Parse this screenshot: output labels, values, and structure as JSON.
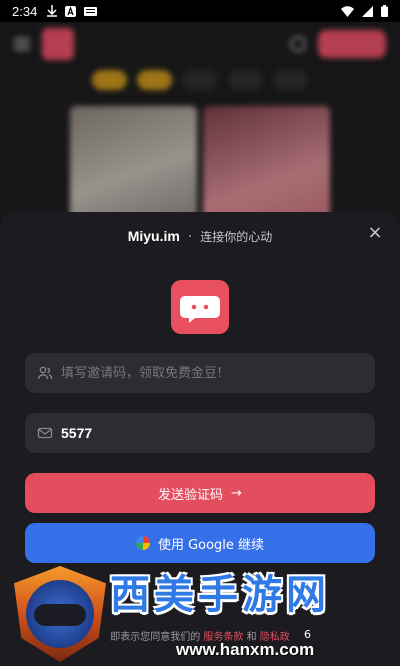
{
  "statusbar": {
    "time": "2:34"
  },
  "sheet": {
    "brand": "Miyu.im",
    "separator": "·",
    "tagline": "连接你的心动",
    "close_label": "×"
  },
  "invite_field": {
    "placeholder": "填写邀请码，领取免费金豆!",
    "value": ""
  },
  "email_field": {
    "value": "5577"
  },
  "send_code_button": {
    "label": "发送验证码",
    "arrow": "→"
  },
  "google_button": {
    "label": "使用 Google 继续"
  },
  "terms": {
    "prefix": "即表示您同意我们的",
    "terms_link": "服务条款",
    "and": "和",
    "privacy_link": "隐私政"
  },
  "watermark": {
    "text": "西美手游网",
    "url": "www.hanxm.com"
  },
  "toast": {
    "number": "6"
  },
  "colors": {
    "accent": "#e34d5e",
    "google_blue": "#3670e8",
    "sheet_bg": "#1c1c20"
  }
}
